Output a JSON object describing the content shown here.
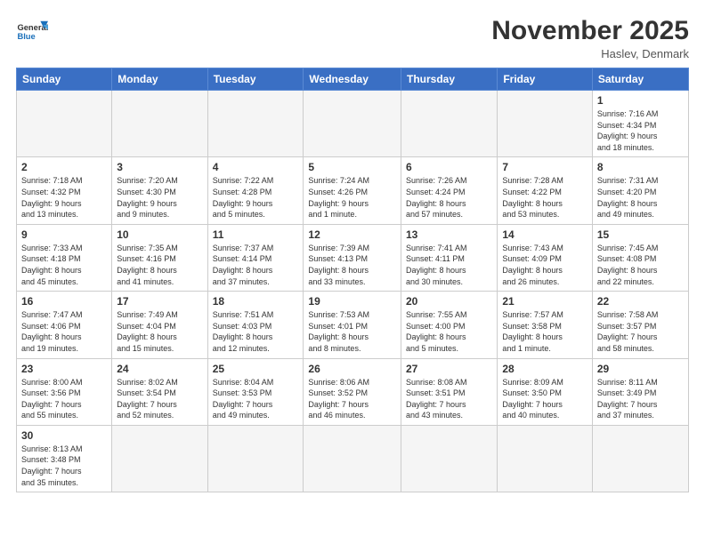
{
  "header": {
    "logo_general": "General",
    "logo_blue": "Blue",
    "month_title": "November 2025",
    "location": "Haslev, Denmark"
  },
  "days_of_week": [
    "Sunday",
    "Monday",
    "Tuesday",
    "Wednesday",
    "Thursday",
    "Friday",
    "Saturday"
  ],
  "weeks": [
    [
      {
        "day": "",
        "info": ""
      },
      {
        "day": "",
        "info": ""
      },
      {
        "day": "",
        "info": ""
      },
      {
        "day": "",
        "info": ""
      },
      {
        "day": "",
        "info": ""
      },
      {
        "day": "",
        "info": ""
      },
      {
        "day": "1",
        "info": "Sunrise: 7:16 AM\nSunset: 4:34 PM\nDaylight: 9 hours\nand 18 minutes."
      }
    ],
    [
      {
        "day": "2",
        "info": "Sunrise: 7:18 AM\nSunset: 4:32 PM\nDaylight: 9 hours\nand 13 minutes."
      },
      {
        "day": "3",
        "info": "Sunrise: 7:20 AM\nSunset: 4:30 PM\nDaylight: 9 hours\nand 9 minutes."
      },
      {
        "day": "4",
        "info": "Sunrise: 7:22 AM\nSunset: 4:28 PM\nDaylight: 9 hours\nand 5 minutes."
      },
      {
        "day": "5",
        "info": "Sunrise: 7:24 AM\nSunset: 4:26 PM\nDaylight: 9 hours\nand 1 minute."
      },
      {
        "day": "6",
        "info": "Sunrise: 7:26 AM\nSunset: 4:24 PM\nDaylight: 8 hours\nand 57 minutes."
      },
      {
        "day": "7",
        "info": "Sunrise: 7:28 AM\nSunset: 4:22 PM\nDaylight: 8 hours\nand 53 minutes."
      },
      {
        "day": "8",
        "info": "Sunrise: 7:31 AM\nSunset: 4:20 PM\nDaylight: 8 hours\nand 49 minutes."
      }
    ],
    [
      {
        "day": "9",
        "info": "Sunrise: 7:33 AM\nSunset: 4:18 PM\nDaylight: 8 hours\nand 45 minutes."
      },
      {
        "day": "10",
        "info": "Sunrise: 7:35 AM\nSunset: 4:16 PM\nDaylight: 8 hours\nand 41 minutes."
      },
      {
        "day": "11",
        "info": "Sunrise: 7:37 AM\nSunset: 4:14 PM\nDaylight: 8 hours\nand 37 minutes."
      },
      {
        "day": "12",
        "info": "Sunrise: 7:39 AM\nSunset: 4:13 PM\nDaylight: 8 hours\nand 33 minutes."
      },
      {
        "day": "13",
        "info": "Sunrise: 7:41 AM\nSunset: 4:11 PM\nDaylight: 8 hours\nand 30 minutes."
      },
      {
        "day": "14",
        "info": "Sunrise: 7:43 AM\nSunset: 4:09 PM\nDaylight: 8 hours\nand 26 minutes."
      },
      {
        "day": "15",
        "info": "Sunrise: 7:45 AM\nSunset: 4:08 PM\nDaylight: 8 hours\nand 22 minutes."
      }
    ],
    [
      {
        "day": "16",
        "info": "Sunrise: 7:47 AM\nSunset: 4:06 PM\nDaylight: 8 hours\nand 19 minutes."
      },
      {
        "day": "17",
        "info": "Sunrise: 7:49 AM\nSunset: 4:04 PM\nDaylight: 8 hours\nand 15 minutes."
      },
      {
        "day": "18",
        "info": "Sunrise: 7:51 AM\nSunset: 4:03 PM\nDaylight: 8 hours\nand 12 minutes."
      },
      {
        "day": "19",
        "info": "Sunrise: 7:53 AM\nSunset: 4:01 PM\nDaylight: 8 hours\nand 8 minutes."
      },
      {
        "day": "20",
        "info": "Sunrise: 7:55 AM\nSunset: 4:00 PM\nDaylight: 8 hours\nand 5 minutes."
      },
      {
        "day": "21",
        "info": "Sunrise: 7:57 AM\nSunset: 3:58 PM\nDaylight: 8 hours\nand 1 minute."
      },
      {
        "day": "22",
        "info": "Sunrise: 7:58 AM\nSunset: 3:57 PM\nDaylight: 7 hours\nand 58 minutes."
      }
    ],
    [
      {
        "day": "23",
        "info": "Sunrise: 8:00 AM\nSunset: 3:56 PM\nDaylight: 7 hours\nand 55 minutes."
      },
      {
        "day": "24",
        "info": "Sunrise: 8:02 AM\nSunset: 3:54 PM\nDaylight: 7 hours\nand 52 minutes."
      },
      {
        "day": "25",
        "info": "Sunrise: 8:04 AM\nSunset: 3:53 PM\nDaylight: 7 hours\nand 49 minutes."
      },
      {
        "day": "26",
        "info": "Sunrise: 8:06 AM\nSunset: 3:52 PM\nDaylight: 7 hours\nand 46 minutes."
      },
      {
        "day": "27",
        "info": "Sunrise: 8:08 AM\nSunset: 3:51 PM\nDaylight: 7 hours\nand 43 minutes."
      },
      {
        "day": "28",
        "info": "Sunrise: 8:09 AM\nSunset: 3:50 PM\nDaylight: 7 hours\nand 40 minutes."
      },
      {
        "day": "29",
        "info": "Sunrise: 8:11 AM\nSunset: 3:49 PM\nDaylight: 7 hours\nand 37 minutes."
      }
    ],
    [
      {
        "day": "30",
        "info": "Sunrise: 8:13 AM\nSunset: 3:48 PM\nDaylight: 7 hours\nand 35 minutes."
      },
      {
        "day": "",
        "info": ""
      },
      {
        "day": "",
        "info": ""
      },
      {
        "day": "",
        "info": ""
      },
      {
        "day": "",
        "info": ""
      },
      {
        "day": "",
        "info": ""
      },
      {
        "day": "",
        "info": ""
      }
    ]
  ]
}
